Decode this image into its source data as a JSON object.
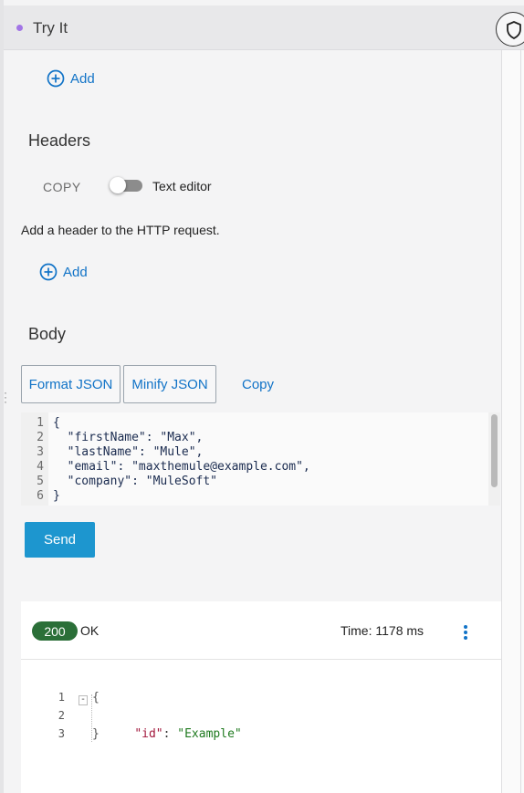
{
  "topbar": {
    "title": "Try It",
    "shield_icon": "shield-icon"
  },
  "query_params": {
    "add_label": "Add"
  },
  "headers": {
    "title": "Headers",
    "copy_label": "COPY",
    "toggle_label": "Text editor",
    "text_editor_enabled": false,
    "hint": "Add a header to the HTTP request.",
    "add_label": "Add"
  },
  "body": {
    "title": "Body",
    "format_label": "Format JSON",
    "minify_label": "Minify JSON",
    "copy_label": "Copy",
    "editor": {
      "line_numbers": [
        "1",
        "2",
        "3",
        "4",
        "5",
        "6"
      ],
      "lines": [
        "{",
        "  \"firstName\": \"Max\",",
        "  \"lastName\": \"Mule\",",
        "  \"email\": \"maxthemule@example.com\",",
        "  \"company\": \"MuleSoft\"",
        "}"
      ]
    },
    "send_label": "Send"
  },
  "response": {
    "status_code": "200",
    "status_text": "OK",
    "time": "Time: 1178 ms",
    "fold_marker": "-",
    "line_numbers": [
      "1",
      "2",
      "3"
    ],
    "open_brace": "{",
    "key": "\"id\"",
    "colon": ": ",
    "value": "\"Example\"",
    "close_brace": "}"
  },
  "colors": {
    "accent": "#1173c7",
    "send_button": "#1d96cf",
    "status_pill": "#2b6f38",
    "json_key": "#a2183c",
    "json_string": "#1f7a1f",
    "dot": "#a275e6"
  }
}
